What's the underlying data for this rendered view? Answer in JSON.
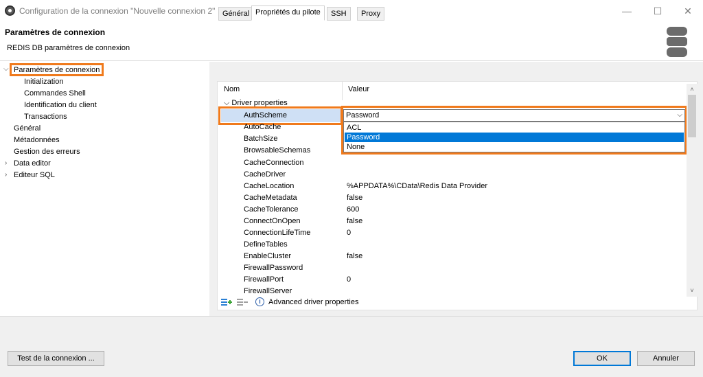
{
  "window": {
    "title": "Configuration de la connexion \"Nouvelle connexion 2\"",
    "controls": {
      "minimize": "—",
      "maximize": "☐",
      "close": "✕"
    }
  },
  "header": {
    "title": "Paramètres de connexion",
    "subtitle": "REDIS DB paramètres de connexion",
    "icon": "database-icon"
  },
  "tree": {
    "items": [
      {
        "label": "Paramètres de connexion",
        "expanded": true,
        "selected": true
      },
      {
        "label": "Initialization"
      },
      {
        "label": "Commandes Shell"
      },
      {
        "label": "Identification du client"
      },
      {
        "label": "Transactions"
      },
      {
        "label": "Général"
      },
      {
        "label": "Métadonnées"
      },
      {
        "label": "Gestion des erreurs"
      },
      {
        "label": "Data editor",
        "collapsed": true
      },
      {
        "label": "Editeur SQL",
        "collapsed": true
      }
    ]
  },
  "tabs": [
    {
      "label": "Général"
    },
    {
      "label": "Propriétés du pilote",
      "active": true
    },
    {
      "label": "SSH"
    },
    {
      "label": "Proxy"
    }
  ],
  "grid": {
    "col_name": "Nom",
    "col_value": "Valeur",
    "group": "Driver properties",
    "rows": [
      {
        "name": "AuthScheme",
        "value": "Password"
      },
      {
        "name": "AutoCache",
        "value": ""
      },
      {
        "name": "BatchSize",
        "value": ""
      },
      {
        "name": "BrowsableSchemas",
        "value": ""
      },
      {
        "name": "CacheConnection",
        "value": ""
      },
      {
        "name": "CacheDriver",
        "value": ""
      },
      {
        "name": "CacheLocation",
        "value": "%APPDATA%\\CData\\Redis Data Provider"
      },
      {
        "name": "CacheMetadata",
        "value": "false"
      },
      {
        "name": "CacheTolerance",
        "value": "600"
      },
      {
        "name": "ConnectOnOpen",
        "value": "false"
      },
      {
        "name": "ConnectionLifeTime",
        "value": "0"
      },
      {
        "name": "DefineTables",
        "value": ""
      },
      {
        "name": "EnableCluster",
        "value": "false"
      },
      {
        "name": "FirewallPassword",
        "value": ""
      },
      {
        "name": "FirewallPort",
        "value": "0"
      },
      {
        "name": "FirewallServer",
        "value": ""
      }
    ],
    "dropdown": {
      "selected": "Password",
      "options": [
        "ACL",
        "Password",
        "None"
      ]
    },
    "footer": {
      "add_icon": "add-property-icon",
      "remove_icon": "remove-property-icon",
      "info_label": "Advanced driver properties"
    }
  },
  "buttons": {
    "test": "Test de la connexion ...",
    "ok": "OK",
    "cancel": "Annuler"
  },
  "colors": {
    "highlight": "#f07a1c",
    "selection": "#0078d7"
  }
}
